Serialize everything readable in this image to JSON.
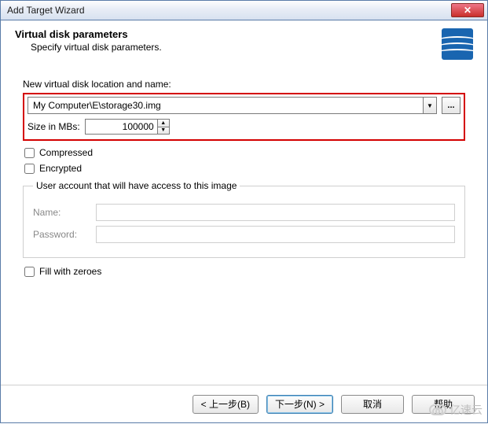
{
  "titlebar": {
    "title": "Add Target Wizard"
  },
  "header": {
    "title": "Virtual disk parameters",
    "subtitle": "Specify virtual disk parameters."
  },
  "location": {
    "label": "New virtual disk location and name:",
    "path": "My Computer\\E\\storage30.img",
    "browse_label": "..."
  },
  "size": {
    "label": "Size in MBs:",
    "value": "100000"
  },
  "checks": {
    "compressed": "Compressed",
    "encrypted": "Encrypted",
    "fill_zeroes": "Fill with zeroes"
  },
  "access_group": {
    "legend": "User account that will have access to this image",
    "name_label": "Name:",
    "password_label": "Password:",
    "name_value": "",
    "password_value": ""
  },
  "footer": {
    "back": "< 上一步(B)",
    "next": "下一步(N) >",
    "cancel": "取消",
    "help": "帮助"
  },
  "watermark": "亿速云"
}
